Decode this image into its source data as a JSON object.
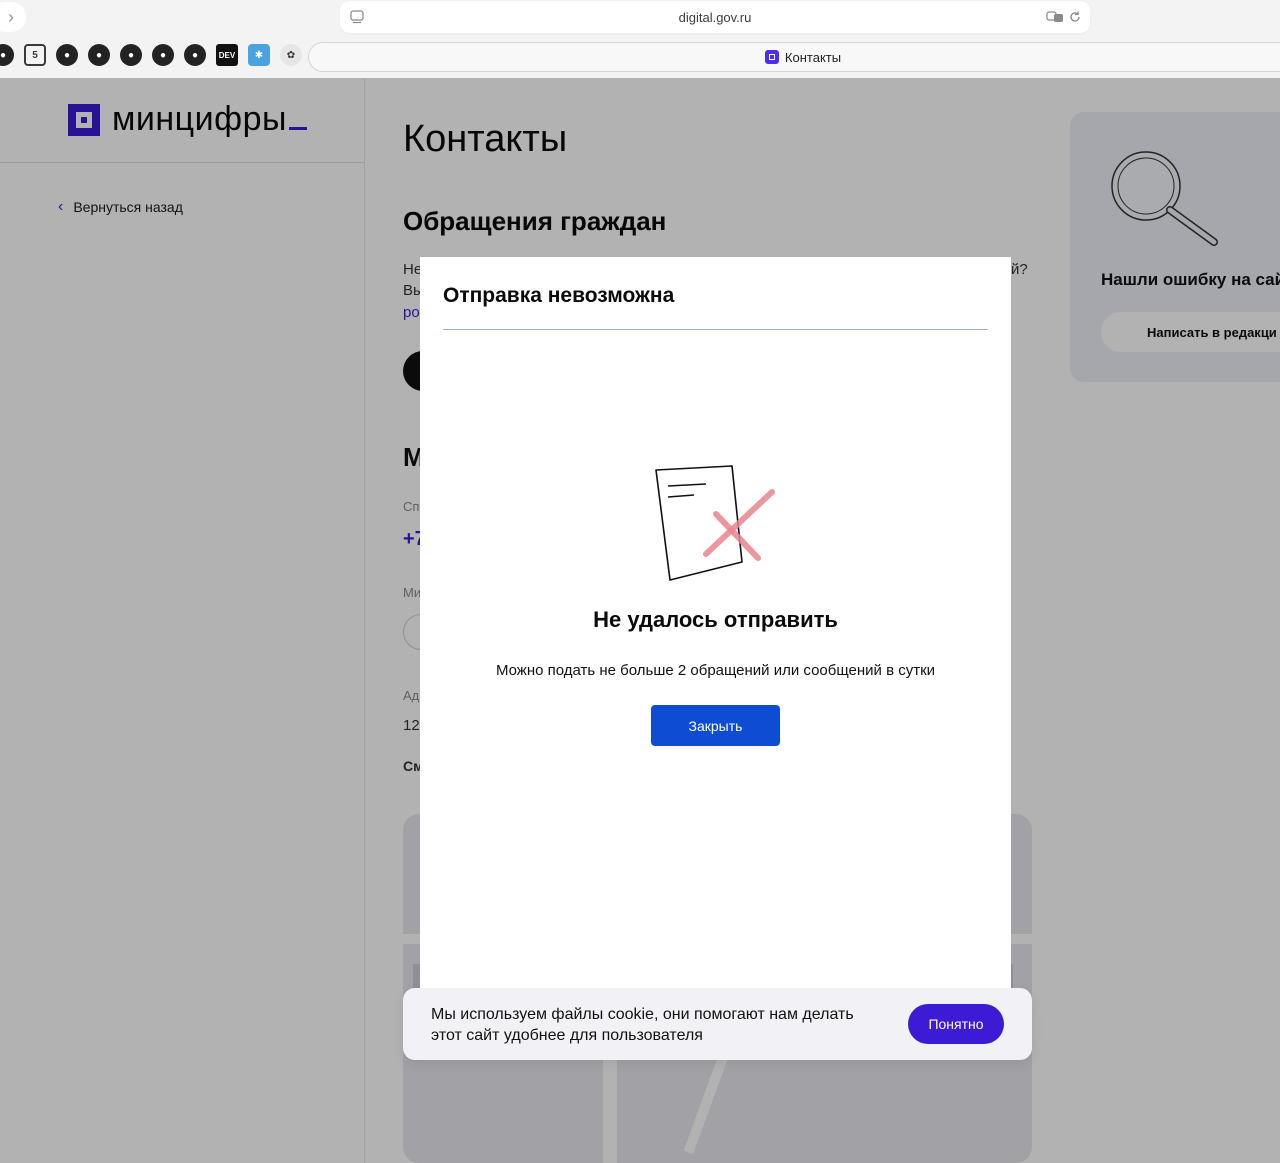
{
  "browser": {
    "url": "digital.gov.ru",
    "tab_title": "Контакты",
    "bookmarks": [
      "github",
      "square-5",
      "github",
      "github",
      "github",
      "github",
      "github",
      "dev",
      "blue-app",
      "owl"
    ]
  },
  "site": {
    "logo_text": "минцифры",
    "back_link": "Вернуться назад",
    "page_title": "Контакты",
    "section_title": "Обращения граждан",
    "fragments": {
      "line1_start": "Не",
      "line1_end": "й?",
      "line2_start": "Вы",
      "line3_link": "ро",
      "section2_start": "М",
      "label_sp": "Сп",
      "phone_start": "+7",
      "label_mi": "Ми",
      "label_ad": "Ад",
      "addr_start": "12",
      "map_link_start": "См"
    },
    "side_card": {
      "text": "Нашли ошибку на сай",
      "button": "Написать в редакци"
    },
    "cookie": {
      "text": "Мы используем файлы cookie, они помогают нам делать этот сайт удобнее для пользователя",
      "button": "Понятно"
    }
  },
  "modal": {
    "title": "Отправка невозможна",
    "heading": "Не удалось отправить",
    "message": "Можно подать не больше 2 обращений или сообщений в сутки",
    "close_button": "Закрыть"
  },
  "colors": {
    "brand": "#3c1ad6",
    "modal_button": "#0d4cd3",
    "error_cross": "#e8868c"
  }
}
